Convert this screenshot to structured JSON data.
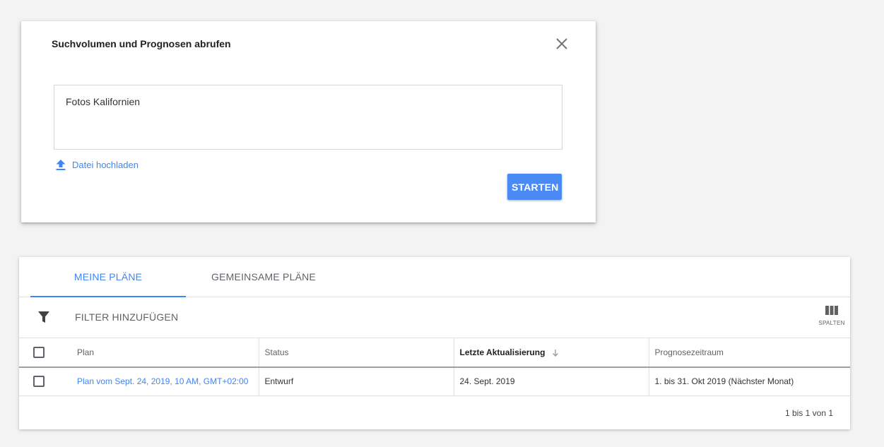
{
  "dialog": {
    "title": "Suchvolumen und Prognosen abrufen",
    "keyword_value": "Fotos Kalifornien",
    "upload_label": "Datei hochladen",
    "start_label": "STARTEN",
    "close_icon": "close-icon",
    "upload_icon": "upload-icon"
  },
  "plans": {
    "tabs": [
      {
        "label": "MEINE PLÄNE",
        "active": true
      },
      {
        "label": "GEMEINSAME PLÄNE",
        "active": false
      }
    ],
    "filter_label": "FILTER HINZUFÜGEN",
    "filter_icon": "filter-icon",
    "columns_label": "SPALTEN",
    "columns_icon": "columns-icon",
    "table": {
      "headers": [
        "Plan",
        "Status",
        "Letzte Aktualisierung",
        "Prognosezeitraum"
      ],
      "sorted_column": "Letzte Aktualisierung",
      "sort_direction": "descending",
      "rows": [
        {
          "plan": "Plan vom Sept. 24, 2019, 10 AM, GMT+02:00",
          "status": "Entwurf",
          "updated": "24. Sept. 2019",
          "period": "1. bis 31. Okt 2019 (Nächster Monat)"
        }
      ]
    },
    "pagination": "1 bis 1 von 1"
  },
  "colors": {
    "accent": "#4285f4",
    "button": "#4a8af4",
    "background": "#f3f3f3"
  }
}
